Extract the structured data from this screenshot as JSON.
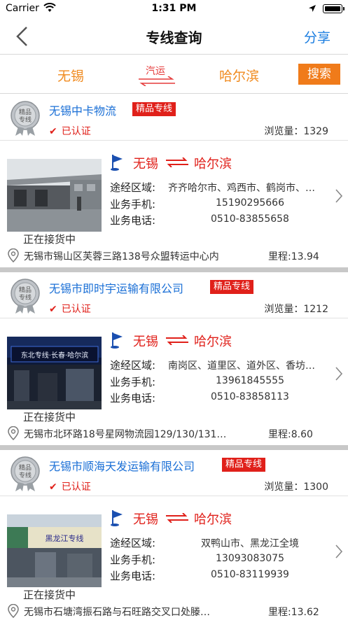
{
  "status_bar": {
    "carrier": "Carrier",
    "time": "1:31 PM"
  },
  "nav": {
    "title": "专线查询",
    "share": "分享"
  },
  "search": {
    "from": "无锡",
    "to": "哈尔滨",
    "mode": "汽运",
    "button": "搜索"
  },
  "labels": {
    "premium": "精品专线",
    "verified": "已认证",
    "views_prefix": "浏览量：",
    "loading": "正在接货中",
    "via": "途经区域:",
    "mobile": "业务手机:",
    "phone": "业务电话:",
    "mileage_prefix": "里程:",
    "medal_line1": "精品",
    "medal_line2": "专线"
  },
  "listings": [
    {
      "company": "无锡中卡物流",
      "views": "1329",
      "from": "无锡",
      "to": "哈尔滨",
      "via": "齐齐哈尔市、鸡西市、鹤岗市、…",
      "mobile": "15190295666",
      "phone": "0510-83855658",
      "address": "无锡市锡山区芙蓉三路138号众盟转运中心内",
      "mileage": "13.94"
    },
    {
      "company": "无锡市即时宇运输有限公司",
      "views": "1212",
      "from": "无锡",
      "to": "哈尔滨",
      "via": "南岗区、道里区、道外区、香坊…",
      "mobile": "13961845555",
      "phone": "0510-83858113",
      "address": "无锡市北环路18号星网物流园129/130/131…",
      "mileage": "8.60",
      "sign_text": "东北专线·长春·哈尔滨"
    },
    {
      "company": "无锡市顺海天发运输有限公司",
      "views": "1300",
      "from": "无锡",
      "to": "哈尔滨",
      "via": "双鸭山市、黑龙江全境",
      "mobile": "13093083075",
      "phone": "0510-83119939",
      "address": "无锡市石塘湾振石路与石旺路交叉口处滕…",
      "mileage": "13.62",
      "sign_text": "黑龙江专线"
    }
  ],
  "colors": {
    "accent": "#f07b1a",
    "link": "#1a7de0",
    "red": "#e0201a"
  }
}
